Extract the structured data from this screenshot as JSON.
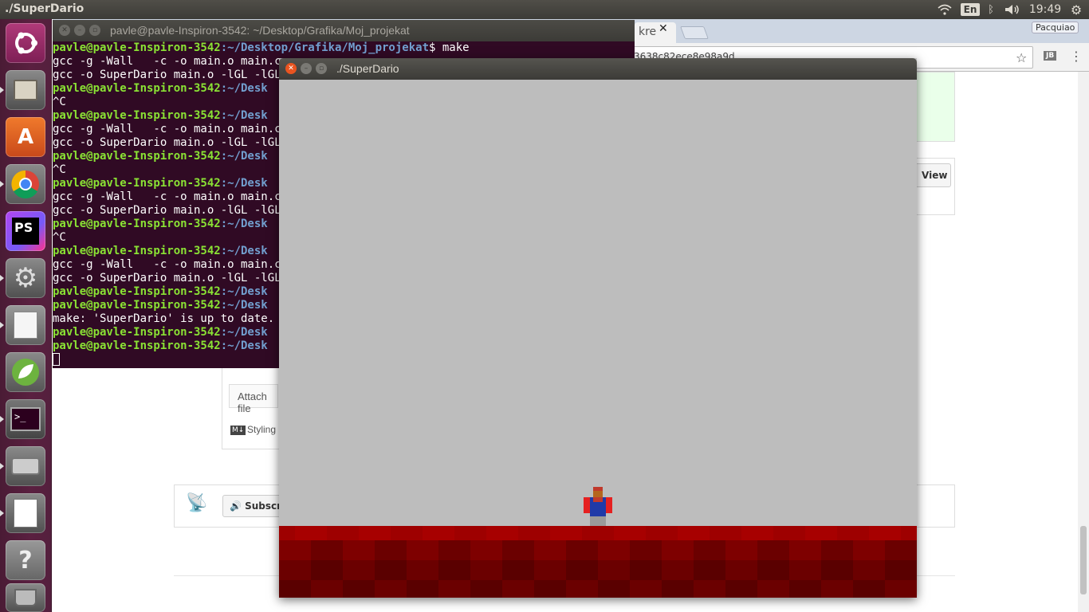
{
  "top_panel": {
    "title": "./SuperDario",
    "keyboard_layout": "En",
    "time": "19:49",
    "icons": [
      "wifi-icon",
      "bluetooth-icon",
      "volume-icon",
      "settings-icon"
    ]
  },
  "launcher": {
    "items": [
      {
        "name": "ubuntu-dash",
        "label": ""
      },
      {
        "name": "files",
        "label": ""
      },
      {
        "name": "software-center",
        "label": "A"
      },
      {
        "name": "chrome",
        "label": ""
      },
      {
        "name": "phpstorm",
        "label": "PS"
      },
      {
        "name": "system-settings",
        "label": ""
      },
      {
        "name": "text-editor",
        "label": ""
      },
      {
        "name": "spring",
        "label": ""
      },
      {
        "name": "terminal",
        "label": ">_"
      },
      {
        "name": "printer",
        "label": ""
      },
      {
        "name": "writer",
        "label": ""
      },
      {
        "name": "help",
        "label": "?"
      },
      {
        "name": "trash",
        "label": ""
      }
    ]
  },
  "browser": {
    "tab_label": "kre",
    "profile_name": "Pacquiao",
    "url_fragment": "3638c82ece8e98a9d",
    "view_button": "View",
    "attach_text": "Attach file",
    "styling_text": "Styling",
    "subscribe_text": "Subscr",
    "md_badge": "M↓"
  },
  "terminal": {
    "title": "pavle@pavle-Inspiron-3542: ~/Desktop/Grafika/Moj_projekat",
    "prompt_user": "pavle@pavle-Inspiron-3542",
    "lines": [
      {
        "type": "prompt",
        "path": ":~/Desktop/Grafika/Moj_projekat",
        "cmd": "$ make"
      },
      {
        "type": "out",
        "text": "gcc -g -Wall   -c -o main.o main.c"
      },
      {
        "type": "out",
        "text": "gcc -o SuperDario main.o -lGL -lGLU -lglut"
      },
      {
        "type": "prompt",
        "path": ":~/Desk",
        "cmd": ""
      },
      {
        "type": "out",
        "text": "^C"
      },
      {
        "type": "prompt",
        "path": ":~/Desk",
        "cmd": ""
      },
      {
        "type": "out",
        "text": "gcc -g -Wall   -c -o main.o main.c"
      },
      {
        "type": "out",
        "text": "gcc -o SuperDario main.o -lGL -lGLU -lglut"
      },
      {
        "type": "prompt",
        "path": ":~/Desk",
        "cmd": ""
      },
      {
        "type": "out",
        "text": "^C"
      },
      {
        "type": "prompt",
        "path": ":~/Desk",
        "cmd": ""
      },
      {
        "type": "out",
        "text": "gcc -g -Wall   -c -o main.o main.c"
      },
      {
        "type": "out",
        "text": "gcc -o SuperDario main.o -lGL -lGLU -lglut"
      },
      {
        "type": "prompt",
        "path": ":~/Desk",
        "cmd": ""
      },
      {
        "type": "out",
        "text": "^C"
      },
      {
        "type": "prompt",
        "path": ":~/Desk",
        "cmd": ""
      },
      {
        "type": "out",
        "text": "gcc -g -Wall   -c -o main.o main.c"
      },
      {
        "type": "out",
        "text": "gcc -o SuperDario main.o -lGL -lGLU -lglut"
      },
      {
        "type": "prompt",
        "path": ":~/Desk",
        "cmd": ""
      },
      {
        "type": "prompt",
        "path": ":~/Desk",
        "cmd": ""
      },
      {
        "type": "out",
        "text": "make: 'SuperDario' is up to date."
      },
      {
        "type": "prompt",
        "path": ":~/Desk",
        "cmd": ""
      },
      {
        "type": "prompt",
        "path": ":~/Desk",
        "cmd": ""
      },
      {
        "type": "cursor",
        "text": ""
      }
    ]
  },
  "game_window": {
    "title": "./SuperDario",
    "sky_color": "#bdbdbd",
    "floor_color": "#8b0000"
  }
}
